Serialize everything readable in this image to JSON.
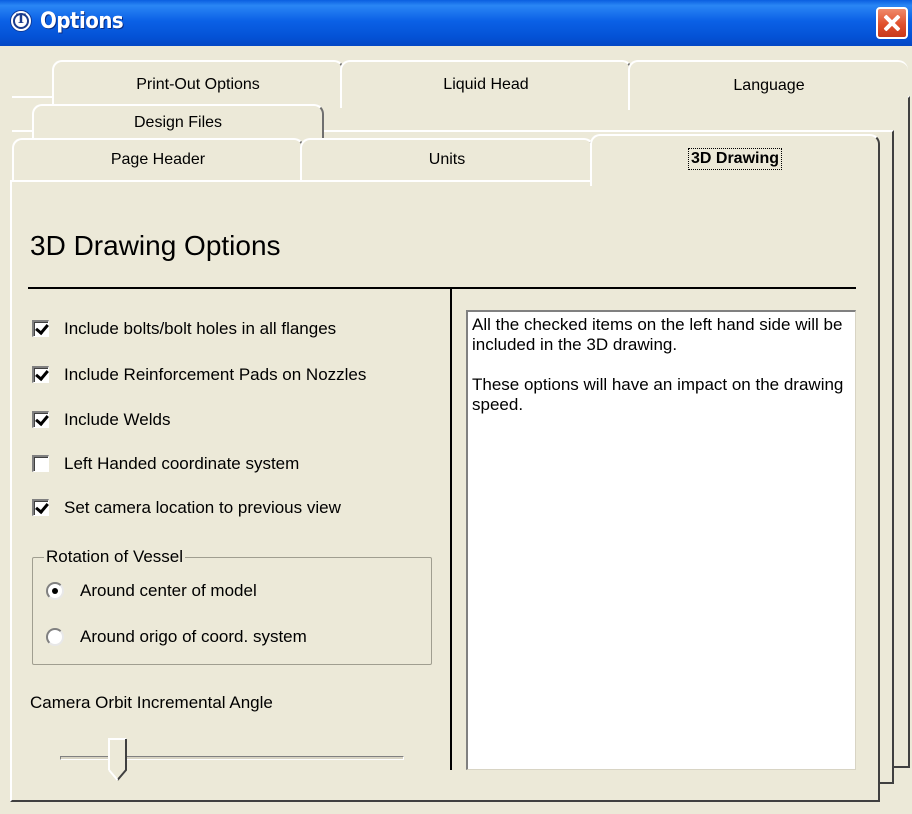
{
  "window": {
    "title": "Options",
    "icon": "app-logo-icon",
    "close_icon": "close-icon",
    "accent": "#0a5fe0",
    "close_color": "#e0502c"
  },
  "tabs": {
    "row3": [
      {
        "label": "Print-Out Options"
      },
      {
        "label": "Liquid Head"
      },
      {
        "label": "Language"
      }
    ],
    "row2": [
      {
        "label": "Design Files"
      }
    ],
    "row1": [
      {
        "label": "Page Header"
      },
      {
        "label": "Units"
      },
      {
        "label": "3D Drawing",
        "selected": true
      }
    ]
  },
  "page": {
    "heading": "3D Drawing Options",
    "checkboxes": [
      {
        "label": "Include bolts/bolt holes in all flanges",
        "checked": true
      },
      {
        "label": "Include Reinforcement Pads on Nozzles",
        "checked": true
      },
      {
        "label": "Include Welds",
        "checked": true
      },
      {
        "label": "Left Handed coordinate system",
        "checked": false
      },
      {
        "label": "Set camera location to previous view",
        "checked": true
      }
    ],
    "rotation_group": {
      "title": "Rotation of Vessel",
      "options": [
        {
          "label": "Around center of model",
          "selected": true
        },
        {
          "label": "Around origo of coord. system",
          "selected": false
        }
      ]
    },
    "orbit": {
      "label": "Camera Orbit Incremental Angle",
      "slider_value": 0.17
    },
    "info": {
      "paragraph1": "All the checked items on the left hand side will be included in the 3D drawing.",
      "paragraph2": "These options will have an impact on the drawing speed."
    }
  }
}
